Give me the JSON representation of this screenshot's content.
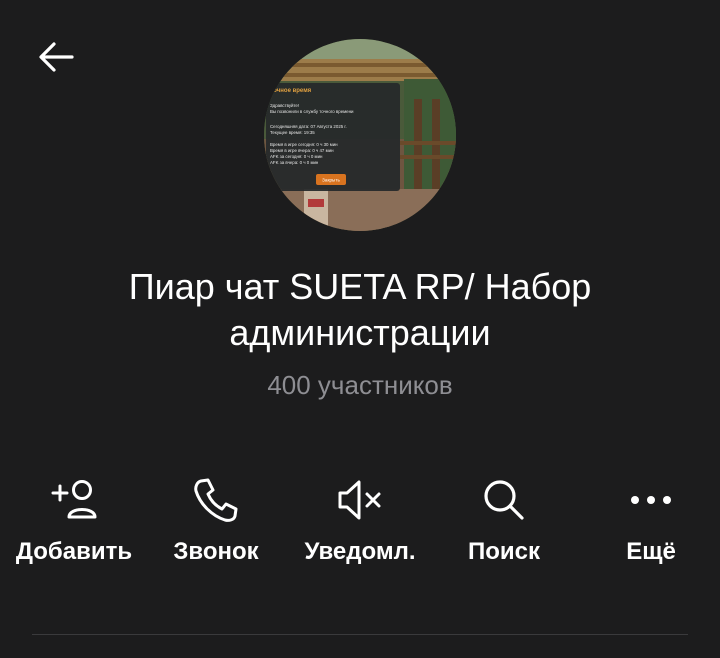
{
  "header": {
    "back_icon": "arrow-left-icon"
  },
  "profile": {
    "title_line1": "Пиар чат SUETA RP/ Набор",
    "title_line2": "администрации",
    "members": "400 участников",
    "avatar": {
      "panel_title": "Точное время",
      "lines": [
        "Здравствуйте!",
        "Вы позвонили в службу точного времени",
        "Сегодняшняя дата: 07 Августа 2025 г.",
        "Текущее время: 19:35",
        "Время в игре сегодня: 0 ч 30 мин",
        "Время в игре вчера: 0 ч 47 мин",
        "AFK за сегодня: 0 ч 0 мин",
        "AFK за вчера: 0 ч 0 мин"
      ],
      "button_label": "Закрыть"
    }
  },
  "actions": [
    {
      "label": "Добавить",
      "icon": "add-user-icon"
    },
    {
      "label": "Звонок",
      "icon": "phone-icon"
    },
    {
      "label": "Уведомл.",
      "icon": "mute-icon"
    },
    {
      "label": "Поиск",
      "icon": "search-icon"
    },
    {
      "label": "Ещё",
      "icon": "more-icon"
    }
  ],
  "colors": {
    "background": "#1c1c1d",
    "text": "#ffffff",
    "secondary_text": "#8e8e93"
  }
}
